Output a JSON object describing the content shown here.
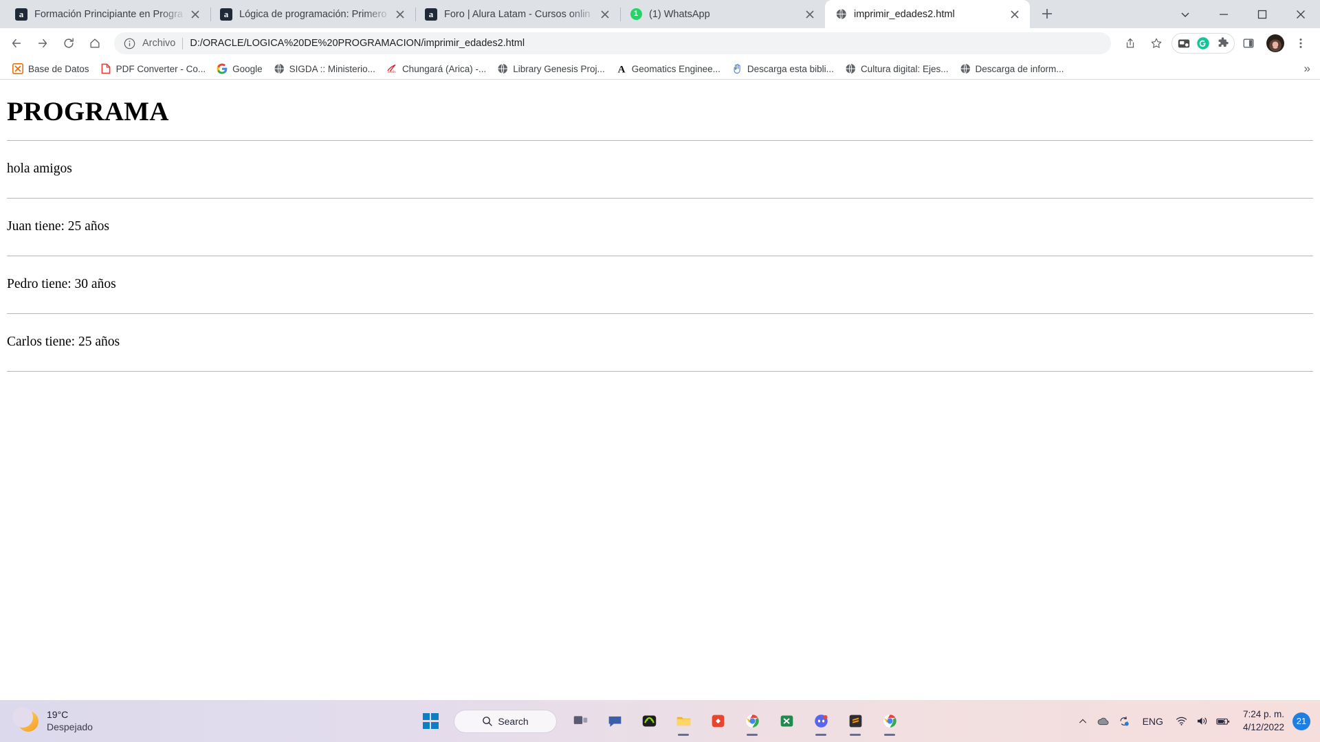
{
  "window": {
    "controls": [
      {
        "name": "tab-search-caret",
        "glyph": "caret-down"
      },
      {
        "name": "minimize",
        "glyph": "minimize"
      },
      {
        "name": "maximize",
        "glyph": "maximize"
      },
      {
        "name": "close",
        "glyph": "close"
      }
    ]
  },
  "tabs": [
    {
      "title": "Formación Principiante en Progra",
      "favicon": "alura-icon",
      "favicon_text": "a",
      "active": false
    },
    {
      "title": "Lógica de programación: Primero",
      "favicon": "alura-icon",
      "favicon_text": "a",
      "active": false
    },
    {
      "title": "Foro | Alura Latam - Cursos onlin",
      "favicon": "alura-icon",
      "favicon_text": "a",
      "active": false
    },
    {
      "title": "(1) WhatsApp",
      "favicon": "whatsapp-icon",
      "favicon_text": "1",
      "active": false
    },
    {
      "title": "imprimir_edades2.html",
      "favicon": "globe-icon",
      "favicon_text": "",
      "active": true
    }
  ],
  "new_tab_label": "+",
  "toolbar": {
    "back_icon": "back-arrow-icon",
    "forward_icon": "forward-arrow-icon",
    "reload_icon": "reload-icon",
    "home_icon": "home-icon",
    "omnibox": {
      "info_icon": "info-circle-icon",
      "scheme_label": "Archivo",
      "url": "D:/ORACLE/LOGICA%20DE%20PROGRAMACION/imprimir_edades2.html"
    },
    "share_icon": "share-icon",
    "bookmark_icon": "star-icon",
    "extensions": [
      {
        "name": "screen-recorder-extension-icon"
      },
      {
        "name": "grammarly-extension-icon"
      },
      {
        "name": "puzzle-extensions-icon"
      }
    ],
    "side_panel_icon": "side-panel-icon",
    "avatar_name": "profile-avatar",
    "menu_icon": "three-dot-menu-icon"
  },
  "bookmarks": {
    "items": [
      {
        "label": "Base de Datos",
        "icon": "db-icon"
      },
      {
        "label": "PDF Converter - Co...",
        "icon": "pdf-icon"
      },
      {
        "label": "Google",
        "icon": "google-icon"
      },
      {
        "label": "SIGDA :: Ministerio...",
        "icon": "globe-icon"
      },
      {
        "label": "Chungará (Arica) -...",
        "icon": "scielo-icon"
      },
      {
        "label": "Library Genesis Proj...",
        "icon": "globe-icon"
      },
      {
        "label": "Geomatics Enginee...",
        "icon": "letter-a-icon"
      },
      {
        "label": "Descarga esta bibli...",
        "icon": "hand-icon"
      },
      {
        "label": "Cultura digital: Ejes...",
        "icon": "globe-icon"
      },
      {
        "label": "Descarga de inform...",
        "icon": "globe-icon"
      }
    ],
    "overflow_label": "»"
  },
  "content": {
    "heading": "PROGRAMA",
    "lines": [
      "hola amigos",
      "Juan tiene: 25 años",
      "Pedro tiene: 30 años",
      "Carlos tiene: 25 años"
    ]
  },
  "taskbar": {
    "weather": {
      "temperature": "19°C",
      "condition": "Despejado",
      "icon": "moon-icon"
    },
    "start_icon": "windows-start-icon",
    "search_label": "Search",
    "search_icon": "search-icon",
    "apps": [
      {
        "name": "task-view-icon",
        "running": false
      },
      {
        "name": "teams-chat-icon",
        "running": false
      },
      {
        "name": "xbox-icon",
        "running": false
      },
      {
        "name": "file-explorer-icon",
        "running": true
      },
      {
        "name": "pdf-app-icon",
        "running": false
      },
      {
        "name": "chrome-icon",
        "running": true
      },
      {
        "name": "excel-app-icon",
        "running": false
      },
      {
        "name": "discord-icon",
        "running": true
      },
      {
        "name": "sublime-text-icon",
        "running": true
      },
      {
        "name": "chrome-active-icon",
        "running": true
      }
    ],
    "tray": {
      "chevron_icon": "chevron-up-icon",
      "onedrive_icon": "onedrive-icon",
      "sync-icon": "sync-icon",
      "language": "ENG",
      "wifi_icon": "wifi-icon",
      "volume_icon": "volume-icon",
      "battery_icon": "battery-charging-icon",
      "time": "7:24 p. m.",
      "date": "4/12/2022",
      "notification_count": "21"
    }
  },
  "colors": {
    "tabstrip_bg": "#dee1e6",
    "omnibox_bg": "#f1f3f4",
    "accent_blue": "#1f7fe0",
    "whatsapp_green": "#25d366",
    "grammarly_green": "#15c39a"
  }
}
